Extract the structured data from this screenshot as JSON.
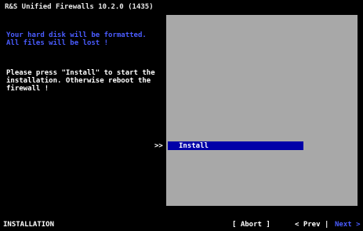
{
  "window": {
    "title": "R&S Unified Firewalls 10.2.0 (1435)"
  },
  "left_panel": {
    "warning": "Your hard disk will be formatted. All files will be lost !",
    "instructions": "Please press \"Install\" to start the installation. Otherwise reboot the firewall !"
  },
  "menu": {
    "selector": ">>",
    "items": [
      {
        "label": "Install",
        "selected": true
      }
    ]
  },
  "footer": {
    "status": "INSTALLATION",
    "abort_label": "[ Abort ]",
    "prev_label": "< Prev",
    "separator": "|",
    "next_label": "Next >"
  },
  "colors": {
    "background": "#000000",
    "panel": "#a8a8a8",
    "selection": "#0000a8",
    "highlight_text": "#4a5cff"
  }
}
